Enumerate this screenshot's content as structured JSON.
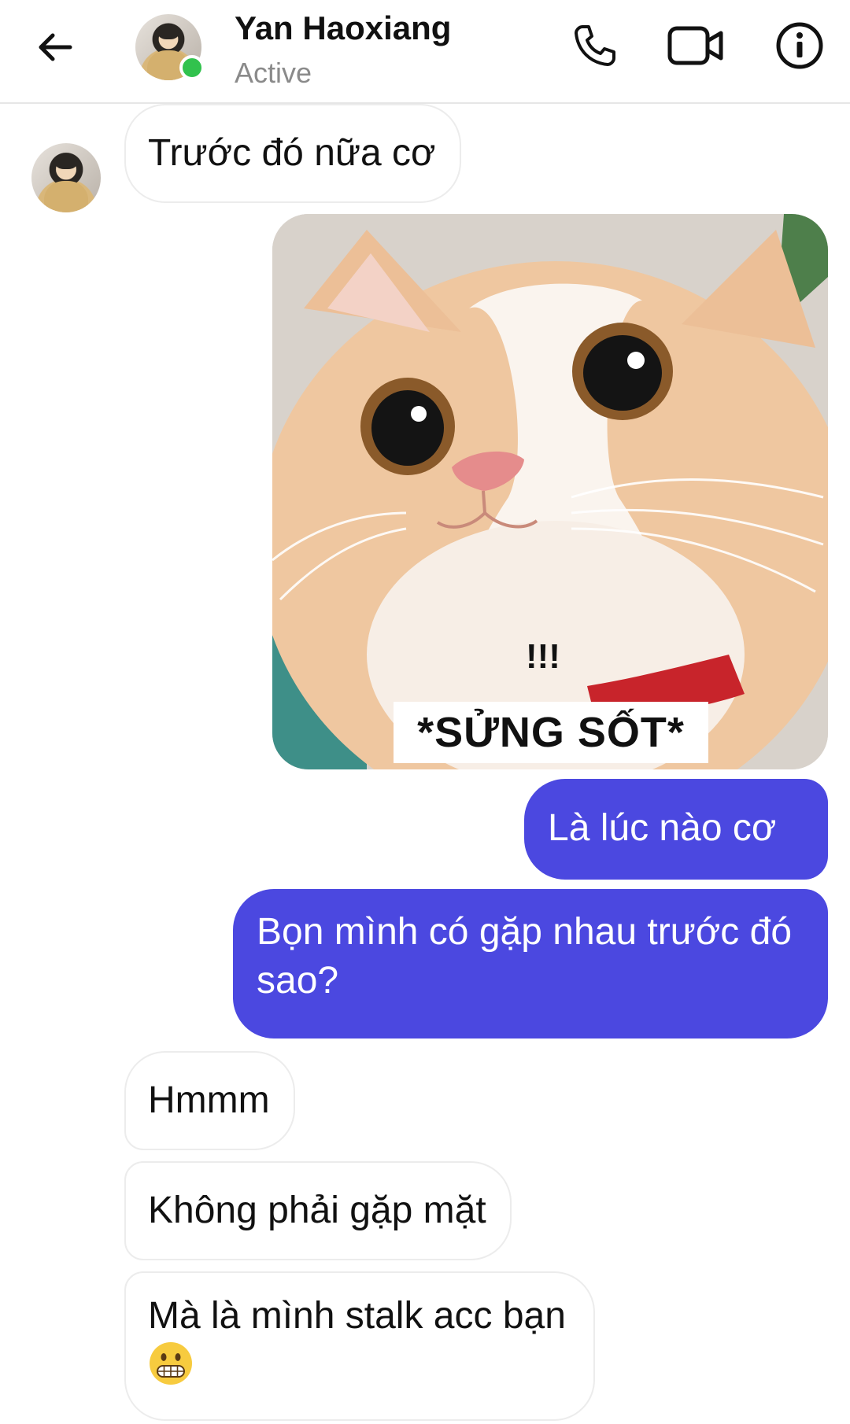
{
  "header": {
    "contact_name": "Yan Haoxiang",
    "status": "Active",
    "icons": [
      "back-arrow-icon",
      "phone-icon",
      "video-camera-icon",
      "info-icon"
    ],
    "online_color": "#31c24d"
  },
  "messages": [
    {
      "from": "contact",
      "type": "text",
      "text": "Trước đó nữa cơ"
    },
    {
      "from": "me",
      "type": "sticker",
      "sticker_text": "!!!",
      "sticker_caption": "*SỬNG SỐT*"
    },
    {
      "from": "me",
      "type": "text",
      "text": "Là lúc nào cơ"
    },
    {
      "from": "me",
      "type": "text",
      "text": "Bọn mình có gặp nhau trước đó sao?"
    },
    {
      "from": "contact",
      "type": "text",
      "text": "Hmmm"
    },
    {
      "from": "contact",
      "type": "text",
      "text": "Không phải gặp mặt"
    },
    {
      "from": "contact",
      "type": "text",
      "text": "Mà là mình stalk acc bạn",
      "emoji": "grimacing-face"
    }
  ],
  "colors": {
    "outgoing_bubble": "#4b48e0",
    "incoming_border": "#ececec"
  }
}
